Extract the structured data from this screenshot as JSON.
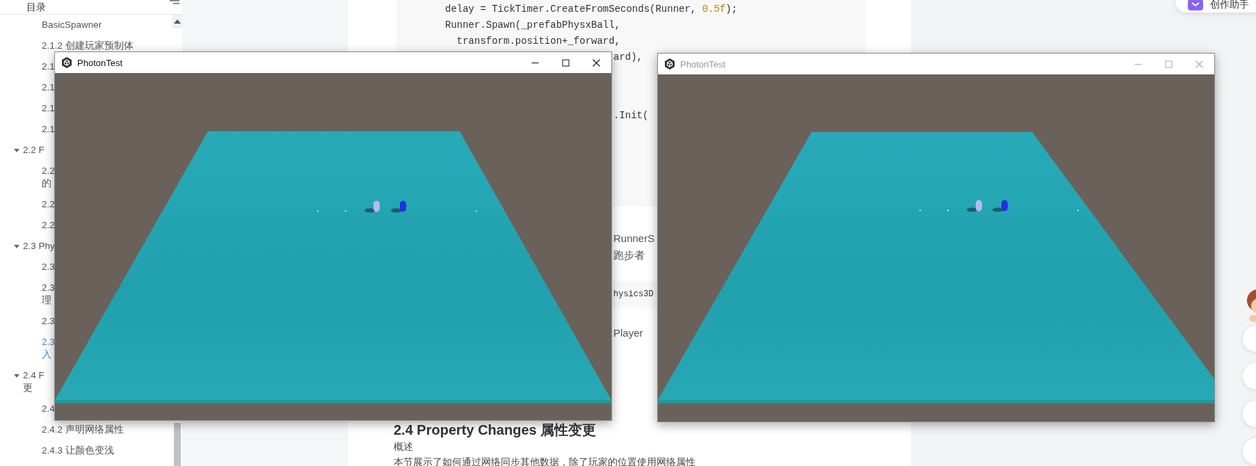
{
  "sidebar": {
    "title": "目录",
    "items": [
      {
        "children": [
          {
            "lines": [
              "BasicSpawner"
            ],
            "selected": false
          },
          {
            "lines": [
              "2.1.2 创建玩家预制体"
            ],
            "selected": false
          },
          {
            "lines": [
              "2.1"
            ],
            "selected": false
          },
          {
            "lines": [
              "2.1"
            ],
            "selected": false
          },
          {
            "lines": [
              "2.1"
            ],
            "selected": false
          },
          {
            "lines": [
              "2.1"
            ],
            "selected": false
          }
        ]
      },
      {
        "lines": [
          "2.2 F"
        ],
        "expanded": true,
        "selected": false,
        "children": [
          {
            "lines": [
              "2.2",
              "的"
            ],
            "selected": false
          },
          {
            "lines": [
              "2.2"
            ],
            "selected": false
          },
          {
            "lines": [
              "2.2"
            ],
            "selected": false
          }
        ]
      },
      {
        "lines": [
          "2.3 Phy"
        ],
        "expanded": true,
        "selected": false,
        "children": [
          {
            "lines": [
              "2.3"
            ],
            "selected": false
          },
          {
            "lines": [
              "2.3",
              "理"
            ],
            "selected": false
          },
          {
            "lines": [
              "2.3"
            ],
            "selected": false
          },
          {
            "lines": [
              "2.3",
              "入"
            ],
            "selected": true
          }
        ]
      },
      {
        "lines": [
          "2.4 F",
          "更"
        ],
        "expanded": true,
        "selected": false,
        "children": [
          {
            "lines": [
              "2.4"
            ],
            "selected": false
          },
          {
            "lines": [
              "2.4.2 声明网络属性"
            ],
            "selected": false
          },
          {
            "lines": [
              "2.4.3 让颜色变浅"
            ],
            "selected": false
          }
        ]
      }
    ]
  },
  "article": {
    "code_lines": [
      {
        "kind": "full",
        "segments": [
          {
            "text": "delay = TickTimer.CreateFromSeconds(Runner, "
          },
          {
            "text": "0.5f",
            "kind": "number"
          },
          {
            "text": ");"
          }
        ]
      },
      {
        "kind": "full",
        "segments": [
          {
            "text": "Runner.Spawn(_prefabPhysxBall,"
          }
        ]
      },
      {
        "kind": "full",
        "segments": [
          {
            "text": "  transform.position+_forward,"
          }
        ]
      },
      {
        "kind": "partial",
        "segments": [
          {
            "text": "ard),"
          }
        ]
      },
      {
        "kind": "partial",
        "segments": [
          {
            "text": ".Init("
          }
        ]
      }
    ],
    "fragments": [
      {
        "kind": "text",
        "text": "RunnerS"
      },
      {
        "kind": "text",
        "text": "跑步者"
      },
      {
        "kind": "code",
        "text": "hysics3D"
      },
      {
        "kind": "text",
        "text": "Player"
      }
    ],
    "heading": "2.4 Property Changes 属性变更",
    "paragraphs": [
      "概述",
      "本节展示了如何通过网络同步其他数据，除了玩家的位置使用网络属性"
    ]
  },
  "assistant_button": {
    "label": "创作助手"
  },
  "windows": [
    {
      "title": "PhotonTest",
      "active": true
    },
    {
      "title": "PhotonTest",
      "active": false
    }
  ]
}
